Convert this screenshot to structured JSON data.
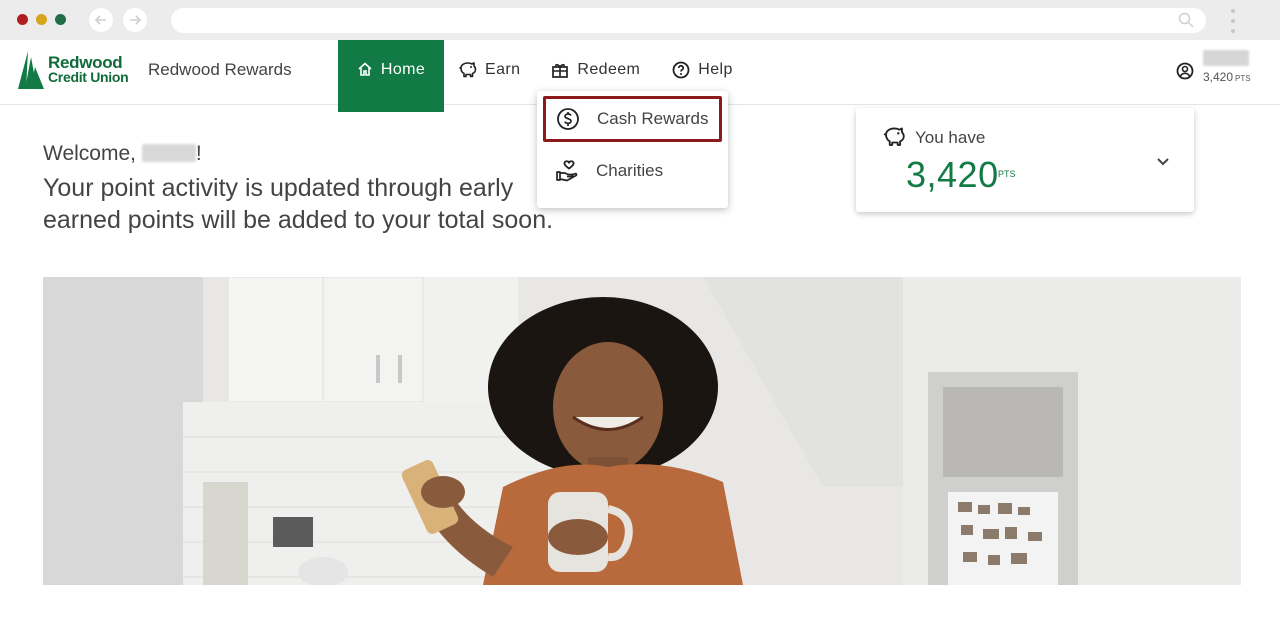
{
  "browser": {
    "back_icon": "arrow-left-icon",
    "forward_icon": "arrow-right-icon",
    "search_icon": "search-icon",
    "menu_icon": "kebab-menu-icon"
  },
  "header": {
    "logo": {
      "line1": "Redwood",
      "line2": "Credit Union"
    },
    "title": "Redwood Rewards",
    "nav": {
      "home": "Home",
      "earn": "Earn",
      "redeem": "Redeem",
      "help": "Help"
    },
    "account": {
      "points": "3,420",
      "unit": "PTS"
    }
  },
  "redeem_menu": {
    "items": [
      {
        "label": "Cash Rewards",
        "icon": "dollar-circle-icon",
        "highlighted": true
      },
      {
        "label": "Charities",
        "icon": "hand-heart-icon",
        "highlighted": false
      }
    ]
  },
  "welcome": {
    "greeting": "Welcome,",
    "punct": "!",
    "message": "Your point activity is updated through early … ly earned points will be added to your total soon.",
    "message_line1": "Your point activity is updated through early",
    "message_line1_tail": "y",
    "message_line2": "earned points will be added to your total soon."
  },
  "points_card": {
    "label": "You have",
    "value": "3,420",
    "unit": "PTS"
  },
  "colors": {
    "brand_green": "#127a45",
    "highlight_border": "#8b1a1a"
  }
}
